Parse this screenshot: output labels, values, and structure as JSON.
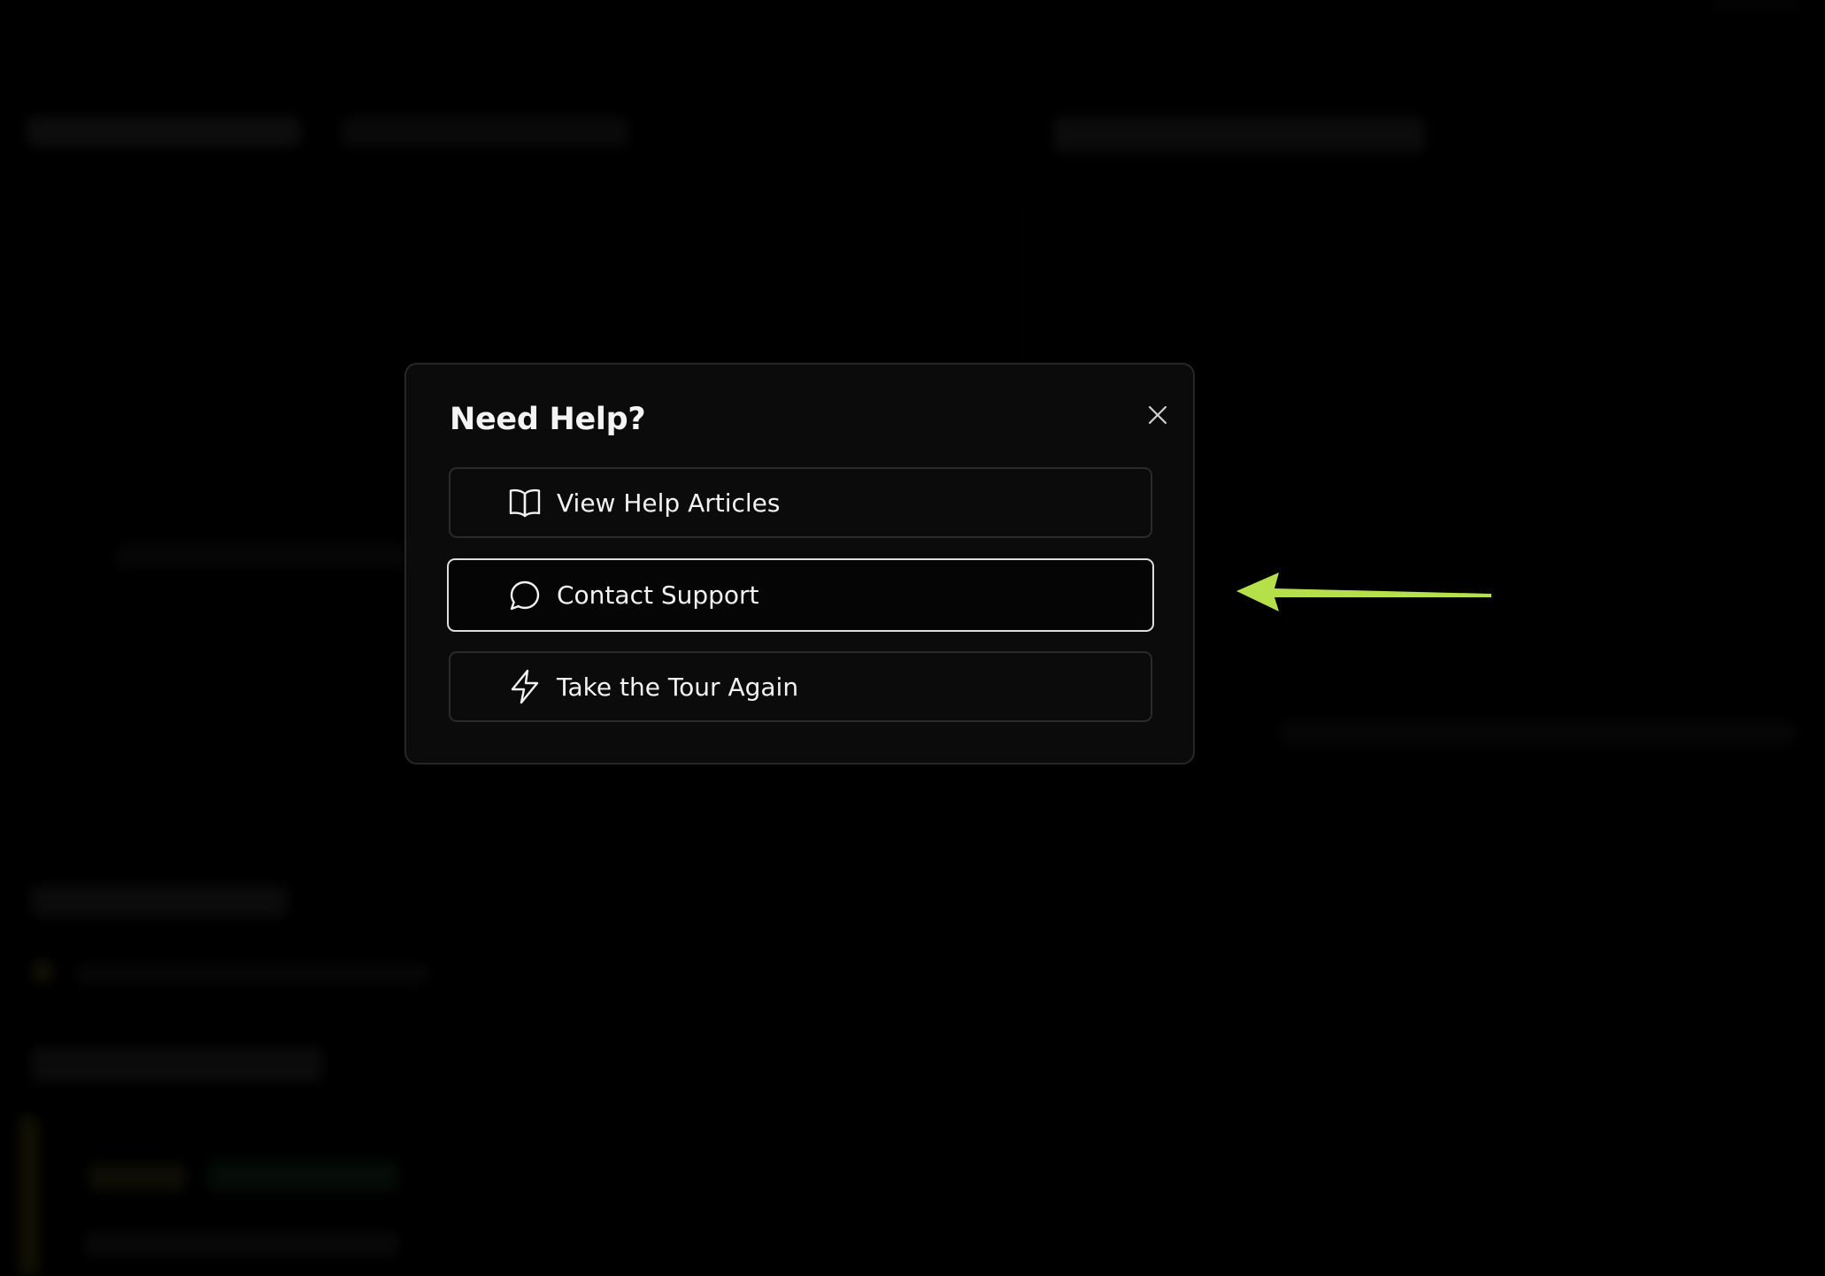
{
  "dialog": {
    "title": "Need Help?",
    "close_icon": "close-icon",
    "options": [
      {
        "label": "View Help Articles",
        "icon": "book-open-icon",
        "selected": false
      },
      {
        "label": "Contact Support",
        "icon": "message-circle-icon",
        "selected": true
      },
      {
        "label": "Take the Tour Again",
        "icon": "lightning-icon",
        "selected": false
      }
    ]
  },
  "annotation": {
    "icon": "arrow-left-icon",
    "color": "#b5e04a"
  },
  "colors": {
    "page_background": "#000000",
    "dialog_background": "#0b0b0b",
    "dialog_border": "#262626",
    "selected_border": "#dedede",
    "text": "#f2f2f2",
    "accent": "#b5e04a"
  }
}
